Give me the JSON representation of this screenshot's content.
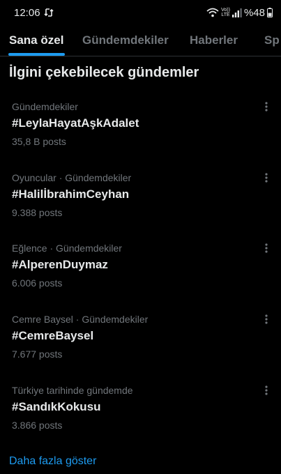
{
  "status_bar": {
    "time": "12:06",
    "network_top": "Vo))",
    "network_bottom": "LTE",
    "battery": "%48",
    "icons": [
      "sync-icon",
      "wifi-icon",
      "signal-icon",
      "battery-icon"
    ]
  },
  "tabs": [
    {
      "label": "Sana özel",
      "active": true
    },
    {
      "label": "Gündemdekiler",
      "active": false
    },
    {
      "label": "Haberler",
      "active": false
    },
    {
      "label": "Sp",
      "active": false
    }
  ],
  "section": {
    "title": "İlgini çekebilecek gündemler"
  },
  "trends": [
    {
      "context": "Gündemdekiler",
      "name": "#LeylaHayatAşkAdalet",
      "count": "35,8 B posts"
    },
    {
      "context": "Oyuncular · Gündemdekiler",
      "name": "#HalilİbrahimCeyhan",
      "count": "9.388 posts"
    },
    {
      "context": "Eğlence · Gündemdekiler",
      "name": "#AlperenDuymaz",
      "count": "6.006 posts"
    },
    {
      "context": "Cemre Baysel · Gündemdekiler",
      "name": "#CemreBaysel",
      "count": "7.677 posts"
    },
    {
      "context": "Türkiye tarihinde gündemde",
      "name": "#SandıkKokusu",
      "count": "3.866 posts"
    }
  ],
  "show_more": "Daha fazla göster",
  "colors": {
    "background": "#000000",
    "text_primary": "#e7e9ea",
    "text_secondary": "#71767b",
    "accent": "#1d9bf0",
    "divider": "#2f3336"
  }
}
